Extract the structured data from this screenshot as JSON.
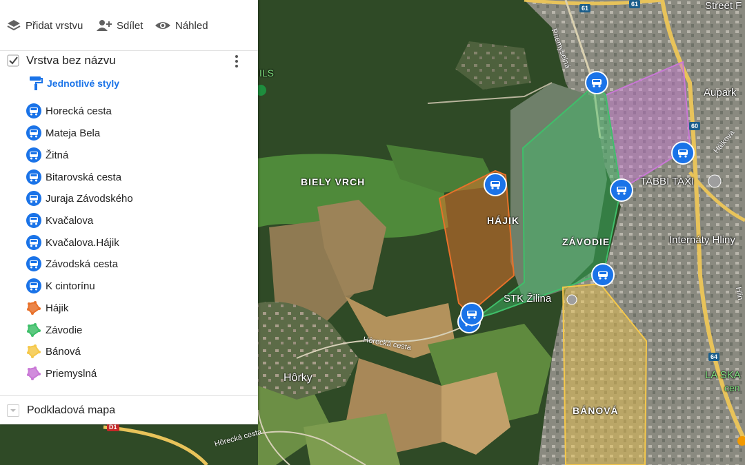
{
  "toolbar": {
    "add_layer": "Přidat vrstvu",
    "share": "Sdílet",
    "preview": "Náhled"
  },
  "layer": {
    "title": "Vrstva bez názvu",
    "checked": true,
    "styles_link": "Jednotlivé styly",
    "items": [
      {
        "label": "Horecká cesta",
        "icon": "bus-icon"
      },
      {
        "label": "Mateja Bela",
        "icon": "bus-icon"
      },
      {
        "label": "Žitná",
        "icon": "bus-icon"
      },
      {
        "label": "Bitarovská cesta",
        "icon": "bus-icon"
      },
      {
        "label": "Juraja Závodského",
        "icon": "bus-icon"
      },
      {
        "label": "Kvačalova",
        "icon": "bus-icon"
      },
      {
        "label": "Kvačalova.Hájik",
        "icon": "bus-icon"
      },
      {
        "label": "Závodská cesta",
        "icon": "bus-icon"
      },
      {
        "label": "K cintorínu",
        "icon": "bus-icon"
      },
      {
        "label": "Hájik",
        "icon": "polygon-icon",
        "color": "#e8712a"
      },
      {
        "label": "Závodie",
        "icon": "polygon-icon",
        "color": "#3fbf6a"
      },
      {
        "label": "Bánová",
        "icon": "polygon-icon",
        "color": "#f5c84a"
      },
      {
        "label": "Priemyslná",
        "icon": "polygon-icon",
        "color": "#c978d6"
      }
    ]
  },
  "base_map": {
    "label": "Podkladová mapa"
  },
  "map": {
    "places": {
      "biely_vrch": "BIELY VRCH",
      "hajik": "HÁJIK",
      "zavodie": "ZÁVODIE",
      "banova": "BÁNOVÁ",
      "horky": "Hôrky",
      "stk": "STK Žilina",
      "tabbi": "TABBI TAXI",
      "internaty": "Internáty Hliny",
      "aupark": "Aupark",
      "street": "Street F",
      "la_ska": "LA SKA",
      "cen": "cen",
      "ils": "ILS",
      "priemyselna": "Priemyselná",
      "halkova": "Hálkova",
      "hlin": "Hlin",
      "horecka1": "Hôrecká cesta",
      "horecka2": "Hôrecká cesta"
    },
    "shields": [
      "61",
      "61",
      "60",
      "64",
      "D1"
    ],
    "colors": {
      "bus_marker": "#1a73e8",
      "hajik": "#e8712a",
      "zavodie": "#3fbf6a",
      "banova": "#f5c84a",
      "priemyslna": "#c978d6"
    }
  }
}
